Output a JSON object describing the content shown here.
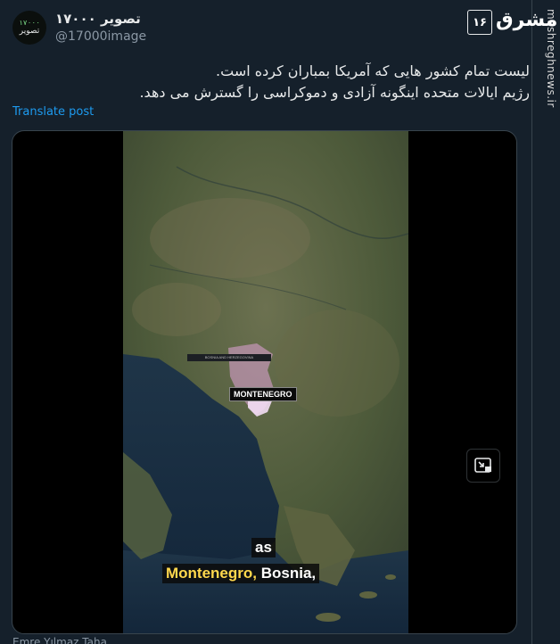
{
  "watermark": {
    "site": "mashreghnews.ir",
    "logo_box": "۱۶",
    "logo_script": "مشرق"
  },
  "author": {
    "avatar_top": "۱۷۰۰۰",
    "avatar_bottom": "تصویر",
    "display_name": "تصویر ۱۷۰۰۰",
    "handle": "@17000image"
  },
  "tweet": {
    "line1": "لیست تمام کشور هایی که آمریکا بمباران کرده است.",
    "line2": "رژیم ایالات متحده اینگونه آزادی و دموکراسی را گسترش می دهد.",
    "translate_label": "Translate post"
  },
  "video": {
    "map_label": "MONTENEGRO",
    "small_tag": "BOSNIA AND HERZEGOVINA",
    "caption_line1": "as",
    "caption_highlight": "Montenegro,",
    "caption_rest": " Bosnia,",
    "pip_icon": "picture-in-picture-icon"
  },
  "footer_peek": "Emre Yılmaz Taha"
}
